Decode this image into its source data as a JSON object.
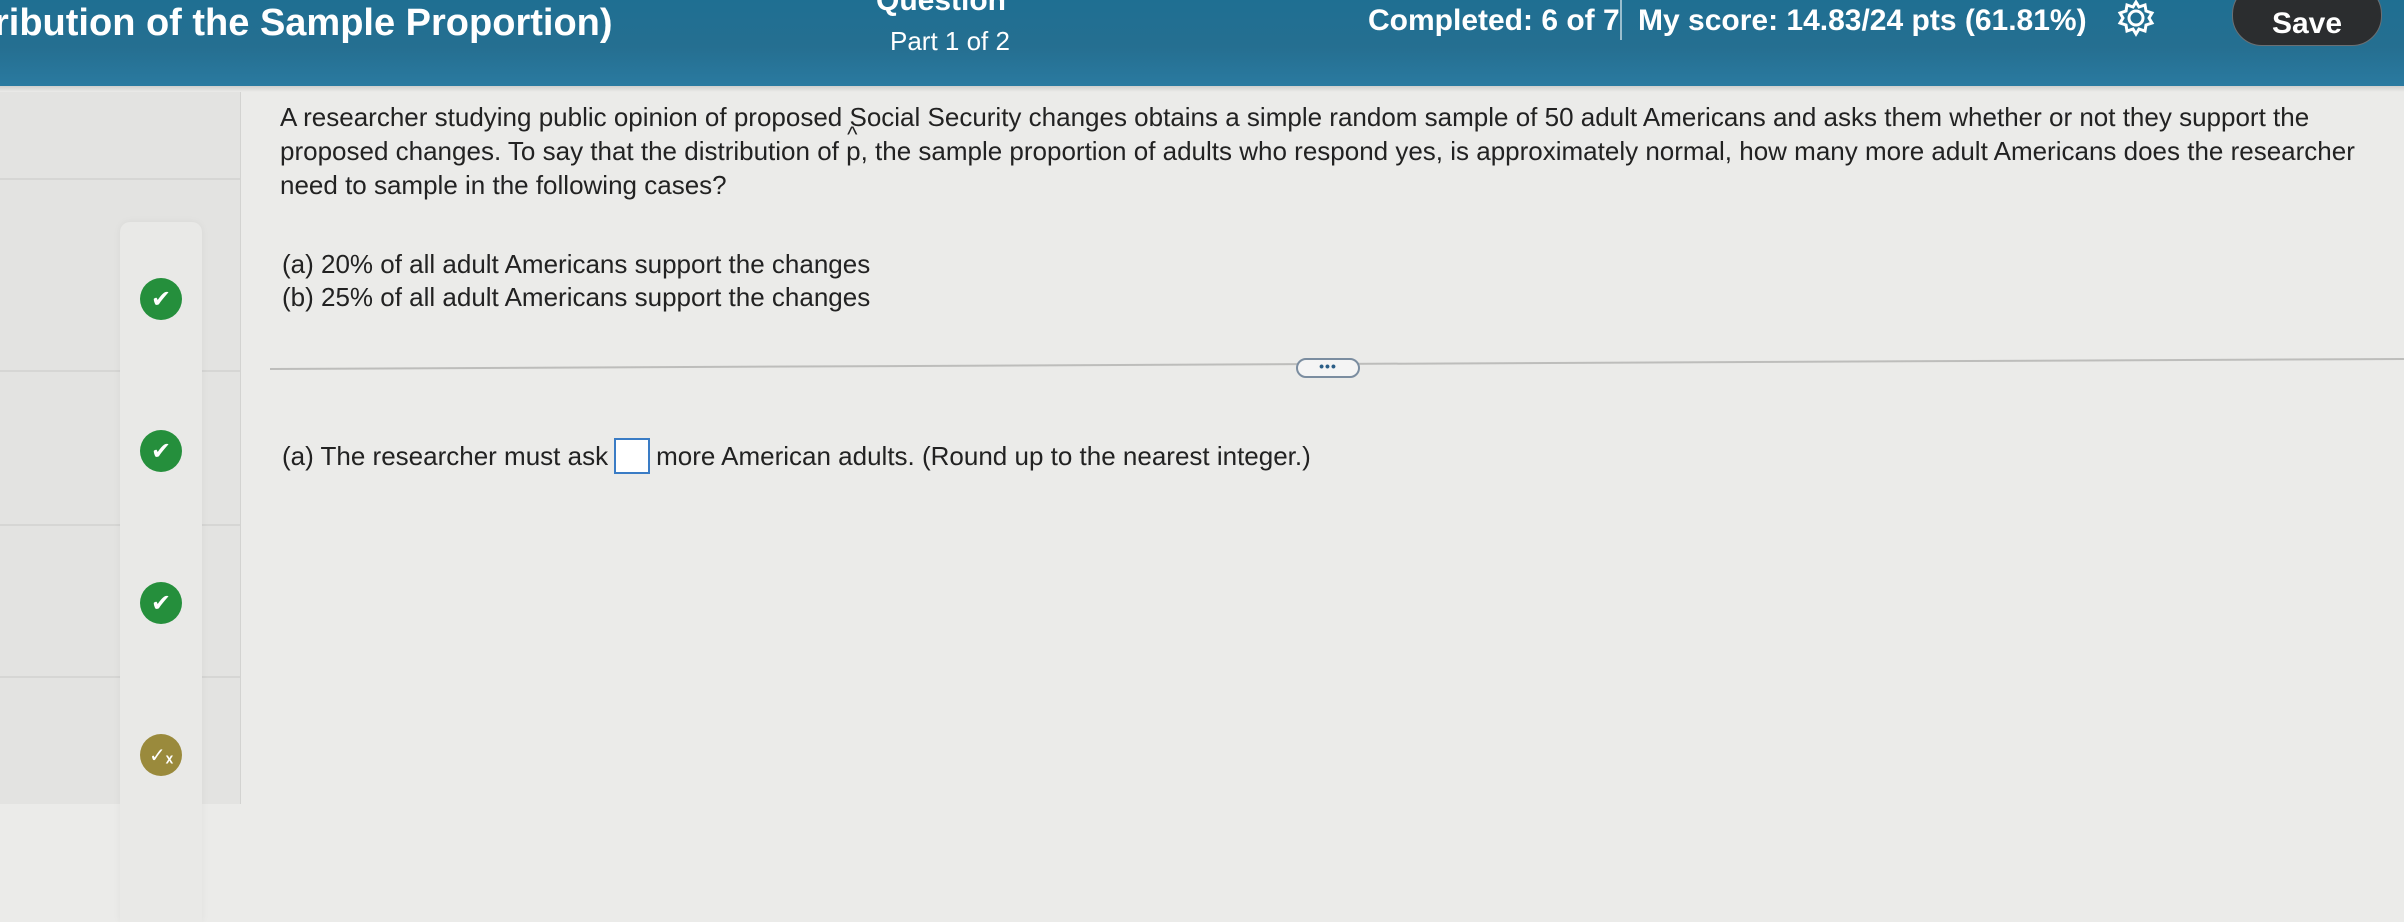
{
  "header": {
    "title": "ribution of the Sample Proportion)",
    "question_label": "Question",
    "part": "Part 1 of 2",
    "completed": "Completed: 6 of 7",
    "score": "My score: 14.83/24 pts (61.81%)",
    "save_label": "Save"
  },
  "question": {
    "text_before": "A researcher studying public opinion of proposed Social Security changes obtains a simple random sample of 50 adult Americans and asks them whether or not they support the proposed changes. To say that the distribution of ",
    "p_symbol": "p",
    "hat_symbol": "^",
    "text_after": ", the sample proportion of adults who respond yes, is approximately normal, how many more adult Americans does the researcher need to sample in the following cases?",
    "cases": [
      "(a) 20% of all adult Americans support the changes",
      "(b) 25% of all adult Americans support the changes"
    ]
  },
  "expand_label": "•••",
  "answer": {
    "prefix": "(a) The researcher must ask",
    "suffix": "more American adults. (Round up to the nearest integer.)",
    "value": ""
  },
  "sidebar": {
    "items": [
      {
        "status": "correct",
        "glyph": "✔"
      },
      {
        "status": "correct",
        "glyph": "✔"
      },
      {
        "status": "correct",
        "glyph": "✔"
      },
      {
        "status": "partial",
        "glyph": "✓ₓ"
      }
    ]
  },
  "colors": {
    "header": "#256f91",
    "correct": "#258f3c",
    "partial": "#9a8a3c",
    "save_button": "#2b2d2f",
    "answer_box_border": "#3a7cc5"
  }
}
